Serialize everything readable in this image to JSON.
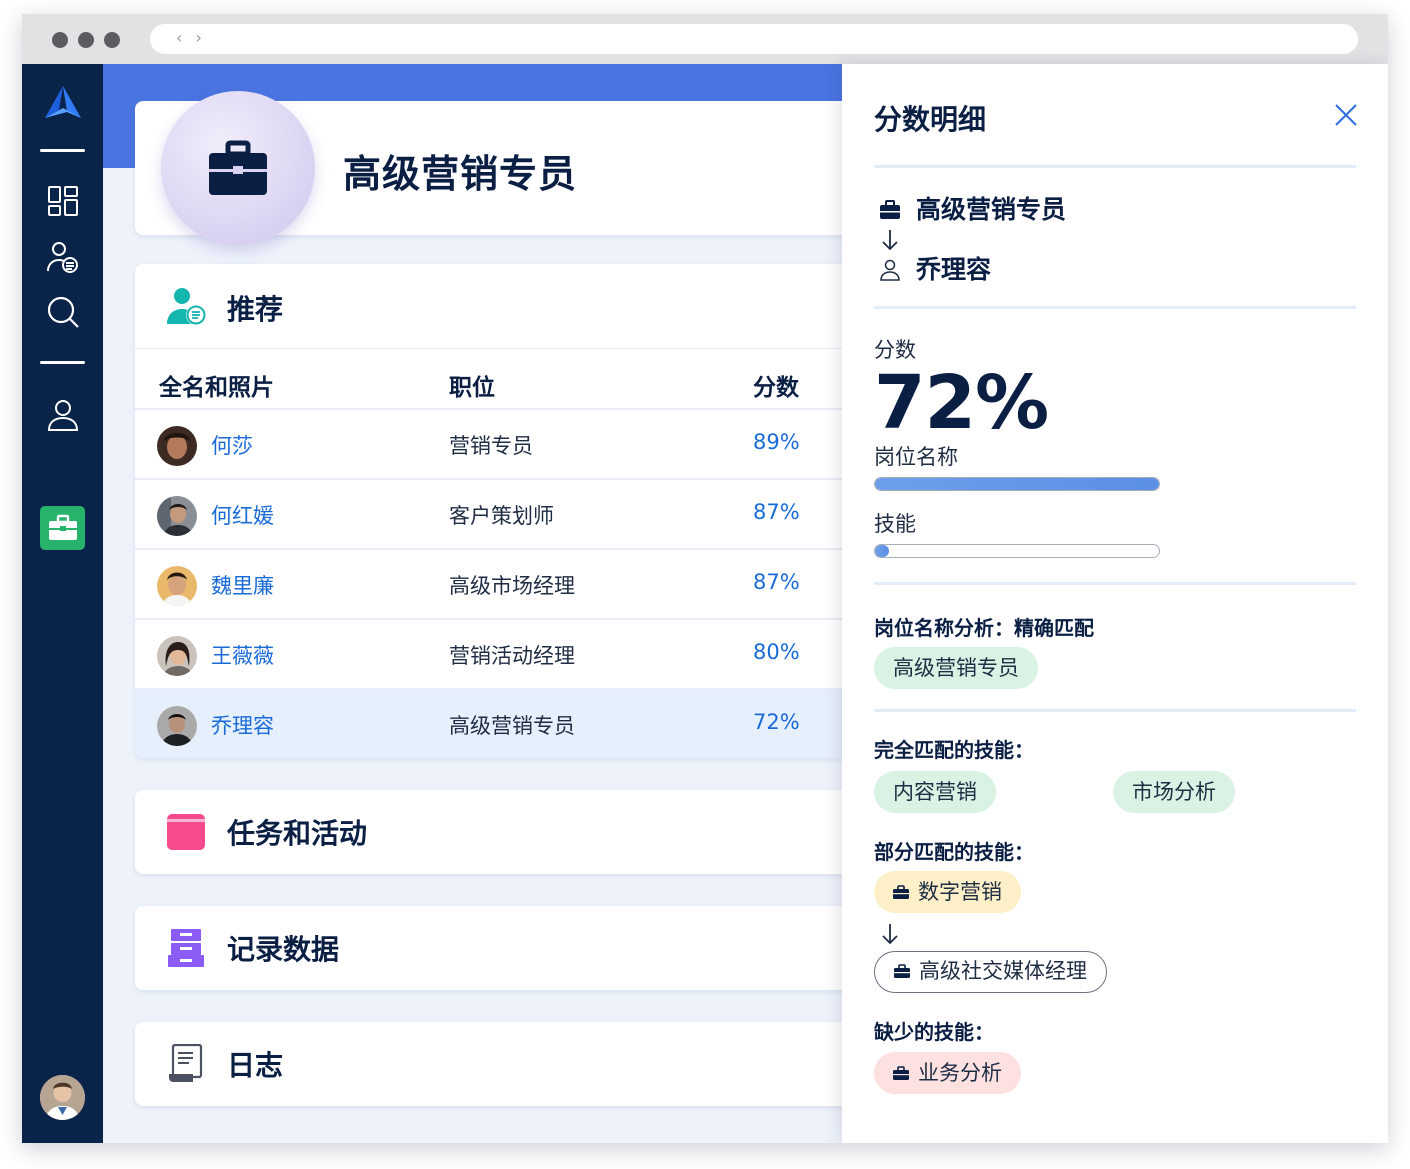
{
  "header": {
    "job_title": "高级营销专员"
  },
  "recommendations": {
    "title": "推荐",
    "columns": [
      "全名和照片",
      "职位",
      "分数"
    ],
    "rows": [
      {
        "name": "何莎",
        "position": "营销专员",
        "score": "89%"
      },
      {
        "name": "何红媛",
        "position": "客户策划师",
        "score": "87%"
      },
      {
        "name": "魏里廉",
        "position": "高级市场经理",
        "score": "87%"
      },
      {
        "name": "王薇薇",
        "position": "营销活动经理",
        "score": "80%"
      },
      {
        "name": "乔理容",
        "position": "高级营销专员",
        "score": "72%"
      }
    ]
  },
  "sections": {
    "tasks": "任务和活动",
    "records": "记录数据",
    "log": "日志"
  },
  "panel": {
    "title": "分数明细",
    "job": "高级营销专员",
    "candidate": "乔理容",
    "score_label": "分数",
    "score_value": "72%",
    "title_bar_label": "岗位名称",
    "title_bar_fraction": 1.0,
    "skills_bar_label": "技能",
    "skills_bar_fraction": 0.05,
    "title_analysis_heading": "岗位名称分析：精确匹配",
    "title_analysis_chip": "高级营销专员",
    "full_match_heading": "完全匹配的技能：",
    "full_match_skills": [
      "内容营销",
      "市场分析"
    ],
    "partial_match_heading": "部分匹配的技能：",
    "partial_from": "数字营销",
    "partial_to": "高级社交媒体经理",
    "missing_heading": "缺少的技能：",
    "missing_skill": "业务分析"
  },
  "colors": {
    "sidebar": "#0a2349",
    "accent_blue": "#4a74e0",
    "link_blue": "#1a6bd8",
    "active_green": "#27b36b"
  }
}
